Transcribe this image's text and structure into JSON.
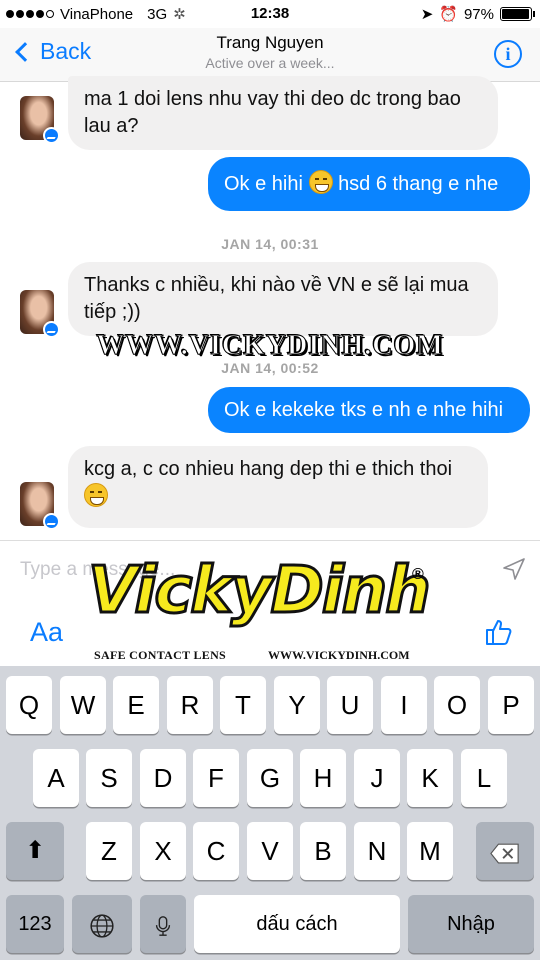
{
  "status_bar": {
    "carrier": "VinaPhone",
    "network": "3G",
    "time": "12:38",
    "battery": "97%"
  },
  "header": {
    "back_label": "Back",
    "contact_name": "Trang Nguyen",
    "status": "Active over a week..."
  },
  "messages": [
    {
      "side": "in",
      "text": "ma 1 doi lens nhu vay thi deo dc trong bao lau a?"
    },
    {
      "side": "out",
      "text_before": "Ok e hihi",
      "emoji": "grinning-emoji",
      "text_after": "hsd 6 thang e nhe"
    },
    {
      "type": "timestamp",
      "text": "JAN 14, 00:31"
    },
    {
      "side": "in",
      "text": "Thanks c nhiều, khi nào về VN e sẽ lại mua tiếp ;))"
    },
    {
      "type": "timestamp",
      "text": "JAN 14, 00:52"
    },
    {
      "side": "out",
      "text": "Ok e kekeke tks e nh e nhe hihi"
    },
    {
      "side": "in",
      "text": "kcg a, c co nhieu hang dep thi e thich thoi",
      "emoji": "smiling-emoji"
    }
  ],
  "watermark": {
    "url_banner": "WWW.VICKYDINH.COM",
    "logo_text": "VickyDinh",
    "registered": "®",
    "tagline": "SAFE CONTACT LENS",
    "logo_url": "WWW.VICKYDINH.COM"
  },
  "composer": {
    "placeholder": "Type a message...",
    "aa_label": "Aa"
  },
  "keyboard": {
    "row1": [
      "Q",
      "W",
      "E",
      "R",
      "T",
      "Y",
      "U",
      "I",
      "O",
      "P"
    ],
    "row2": [
      "A",
      "S",
      "D",
      "F",
      "G",
      "H",
      "J",
      "K",
      "L"
    ],
    "row3": [
      "Z",
      "X",
      "C",
      "V",
      "B",
      "N",
      "M"
    ],
    "numbers_label": "123",
    "space_label": "dấu cách",
    "return_label": "Nhập"
  },
  "colors": {
    "accent": "#0a7cff",
    "outgoing_bubble": "#0a84ff",
    "incoming_bubble": "#f1f0f0",
    "keyboard_bg": "#d2d5db"
  }
}
